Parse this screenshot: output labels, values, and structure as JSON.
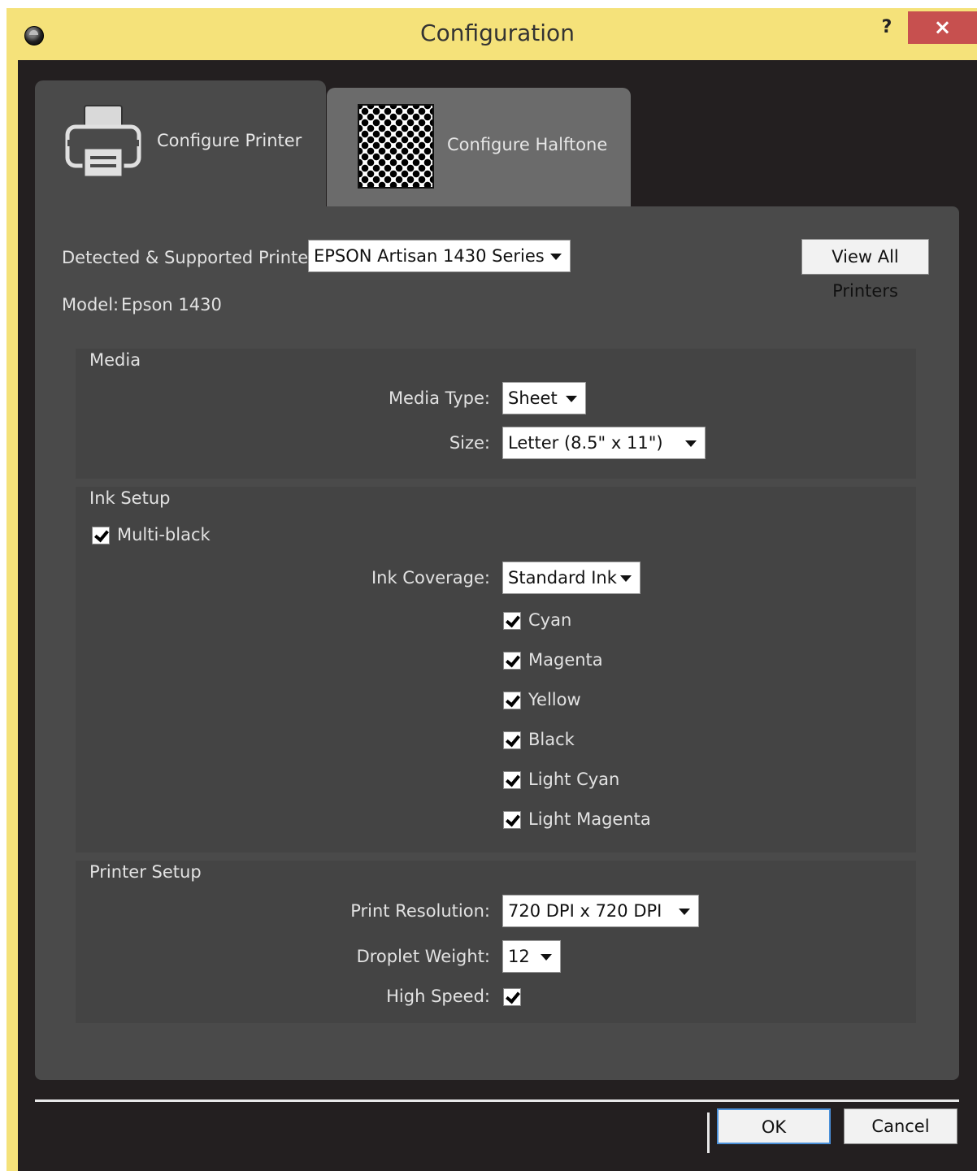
{
  "window": {
    "title": "Configuration",
    "help_label": "?",
    "close_label": "×"
  },
  "tabs": [
    {
      "label": "Configure Printer",
      "icon": "printer-icon"
    },
    {
      "label": "Configure Halftone",
      "icon": "halftone-pattern-icon"
    }
  ],
  "printer": {
    "detected_label": "Detected & Supported Printers:",
    "selected_printer": "EPSON Artisan 1430 Series",
    "view_all_label": "View All Printers",
    "model_label": "Model:",
    "model_value": "Epson 1430"
  },
  "media": {
    "heading": "Media",
    "type_label": "Media Type:",
    "type_value": "Sheet",
    "size_label": "Size:",
    "size_value": "Letter (8.5\" x 11\")"
  },
  "ink": {
    "heading": "Ink Setup",
    "multiblack_label": "Multi-black",
    "multiblack_checked": true,
    "coverage_label": "Ink Coverage:",
    "coverage_value": "Standard Ink",
    "channels": [
      {
        "label": "Cyan",
        "checked": true
      },
      {
        "label": "Magenta",
        "checked": true
      },
      {
        "label": "Yellow",
        "checked": true
      },
      {
        "label": "Black",
        "checked": true
      },
      {
        "label": "Light Cyan",
        "checked": true
      },
      {
        "label": "Light Magenta",
        "checked": true
      }
    ]
  },
  "printer_setup": {
    "heading": "Printer Setup",
    "resolution_label": "Print Resolution:",
    "resolution_value": "720 DPI x 720 DPI",
    "droplet_label": "Droplet Weight:",
    "droplet_value": "12",
    "high_speed_label": "High Speed:",
    "high_speed_checked": true
  },
  "footer": {
    "ok_label": "OK",
    "cancel_label": "Cancel"
  },
  "colors": {
    "title_bar": "#f5e27a",
    "close_button": "#c7504f",
    "panel": "#4a4a4a",
    "client_bg": "#231f20"
  }
}
